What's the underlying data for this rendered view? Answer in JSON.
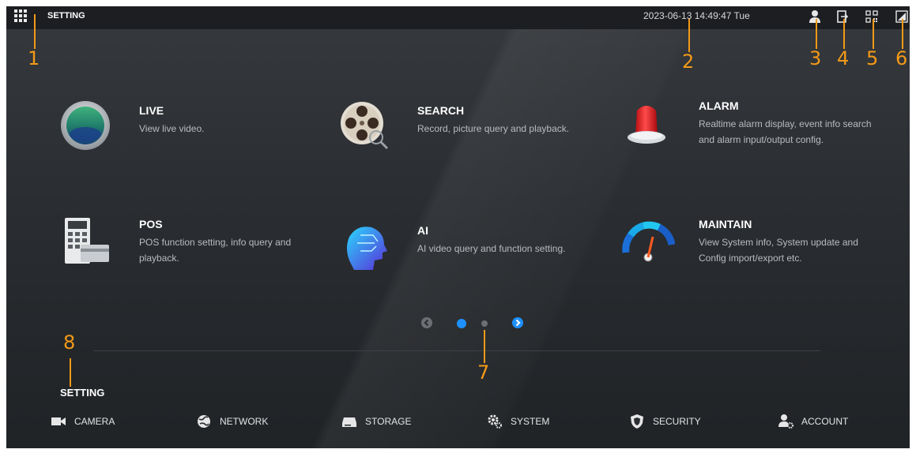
{
  "topbar": {
    "title": "SETTING",
    "datetime": "2023-06-13 14:49:47 Tue",
    "icons": [
      "user-icon",
      "logout-icon",
      "qr-code-icon",
      "fullscreen-icon"
    ]
  },
  "tiles": [
    {
      "name": "LIVE",
      "desc": "View live video.",
      "icon": "live-icon"
    },
    {
      "name": "SEARCH",
      "desc": "Record, picture query and playback.",
      "icon": "search-film-reel-icon"
    },
    {
      "name": "ALARM",
      "desc": "Realtime alarm display, event info search and alarm input/output config.",
      "icon": "alarm-siren-icon"
    },
    {
      "name": "POS",
      "desc": "POS function setting, info query and playback.",
      "icon": "pos-terminal-icon"
    },
    {
      "name": "AI",
      "desc": "AI video query and function setting.",
      "icon": "ai-head-icon"
    },
    {
      "name": "MAINTAIN",
      "desc": "View System info, System update and Config import/export etc.",
      "icon": "gauge-icon"
    }
  ],
  "pagination": {
    "pages": 2,
    "current": 1
  },
  "setting": {
    "title": "SETTING",
    "items": [
      {
        "label": "CAMERA",
        "icon": "camera-icon"
      },
      {
        "label": "NETWORK",
        "icon": "network-globe-icon"
      },
      {
        "label": "STORAGE",
        "icon": "storage-disk-icon"
      },
      {
        "label": "SYSTEM",
        "icon": "gears-icon"
      },
      {
        "label": "SECURITY",
        "icon": "shield-icon"
      },
      {
        "label": "ACCOUNT",
        "icon": "account-icon"
      }
    ]
  },
  "annotations": [
    "1",
    "2",
    "3",
    "4",
    "5",
    "6",
    "7",
    "8"
  ],
  "colors": {
    "accent": "#1e90ff",
    "annotation": "#f39a18",
    "background": "#2b2e32"
  }
}
